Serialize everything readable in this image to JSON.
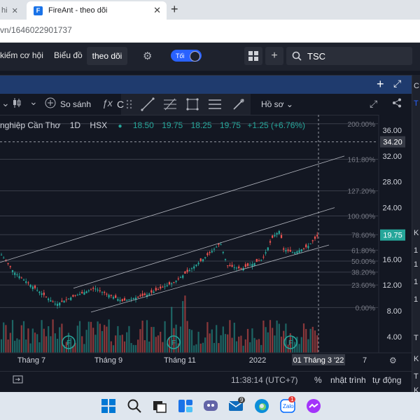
{
  "browser": {
    "tabs": [
      {
        "title": "hi",
        "partial": true
      },
      {
        "title": "FireAnt - theo dõi",
        "favicon": "F",
        "active": true
      }
    ],
    "url": "vn/1646022901737"
  },
  "nav": {
    "items": [
      "kiếm cơ hội",
      "Biểu đồ",
      "theo dõi"
    ],
    "active": "theo dõi",
    "theme_toggle": "Tối",
    "search_value": "TSC"
  },
  "toolbar": {
    "compare": "So sánh",
    "profile": "Hồ sơ",
    "fx_label": "C"
  },
  "legend": {
    "name": "nghiệp Cần Thơ",
    "interval": "1D",
    "exchange": "HSX",
    "open": "18.50",
    "high": "19.75",
    "low": "18.25",
    "close": "19.75",
    "change": "+1.25 (+6.76%)"
  },
  "price_axis": {
    "ticks": [
      "36.00",
      "32.00",
      "28.00",
      "24.00",
      "20.00",
      "16.00",
      "12.00",
      "8.00",
      "4.00"
    ],
    "crosshair_price": "34.20",
    "last_price": "19.75"
  },
  "fib_levels": [
    "200.00%",
    "161.80%",
    "127.20%",
    "100.00%",
    "78.60%",
    "61.80%",
    "50.00%",
    "38.20%",
    "23.60%",
    "0.00%"
  ],
  "time_axis": {
    "ticks": [
      "Tháng 7",
      "Tháng 9",
      "Tháng 11",
      "2022",
      "7"
    ],
    "crosshair_date": "01 Tháng 3 '22"
  },
  "status": {
    "time": "11:38:14 (UTC+7)",
    "percent": "%",
    "log_label": "nhật trình",
    "auto_label": "tự động"
  },
  "right_panel_chars": [
    "C",
    "T",
    "K",
    "1",
    "1",
    "1",
    "1",
    "T",
    "K",
    "T",
    "K"
  ],
  "colors": {
    "up": "#26a69a",
    "down": "#ef5350",
    "accent": "#2962ff",
    "bg": "#131722"
  },
  "taskbar": {
    "badges": {
      "teams": "9",
      "zalo": "1"
    }
  }
}
